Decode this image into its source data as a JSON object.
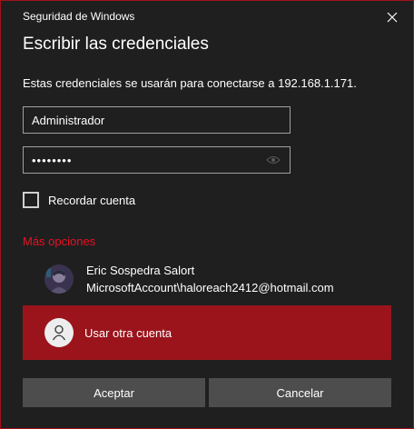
{
  "window": {
    "title": "Seguridad de Windows",
    "accent_color": "#e81123",
    "selected_color": "#9b141c"
  },
  "heading": "Escribir las credenciales",
  "description": "Estas credenciales se usarán para conectarse a 192.168.1.171.",
  "username_field": {
    "value": "Administrador"
  },
  "password_field": {
    "masked_value": "••••••••",
    "reveal_icon": "eye-icon"
  },
  "remember": {
    "label": "Recordar cuenta",
    "checked": false
  },
  "more_options": {
    "label": "Más opciones"
  },
  "accounts": [
    {
      "name": "Eric Sospedra Salort",
      "id": "MicrosoftAccount\\haloreach2412@hotmail.com",
      "avatar_icon": "user-photo"
    }
  ],
  "other_account": {
    "label": "Usar otra cuenta",
    "icon": "person-icon"
  },
  "buttons": {
    "ok": "Aceptar",
    "cancel": "Cancelar"
  }
}
